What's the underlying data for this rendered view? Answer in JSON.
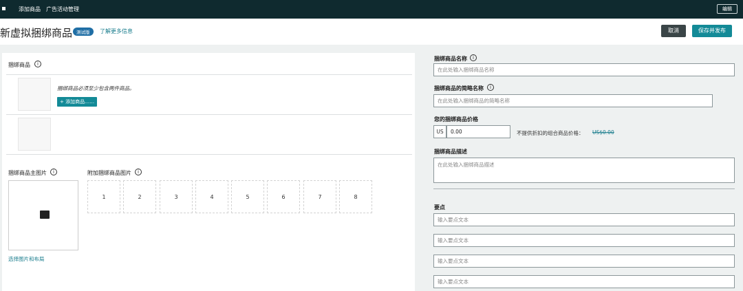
{
  "topbar": {
    "nav1": "添加商品",
    "nav2": "广告活动管理",
    "edit": "编辑"
  },
  "header": {
    "title": "新虚拟捆绑商品",
    "badge": "测试版",
    "learn_more": "了解更多信息",
    "cancel": "取消",
    "save_publish": "保存并发布"
  },
  "left": {
    "bundle_label": "捆绑商品",
    "bundle_hint": "捆绑商品必须至少包含两件商品。",
    "add_product": "+ 添加商品……",
    "main_image_label": "捆绑商品主图片",
    "extra_images_label": "附加捆绑商品图片",
    "slots": [
      "1",
      "2",
      "3",
      "4",
      "5",
      "6",
      "7",
      "8"
    ],
    "choose_image": "选择图片和布局"
  },
  "right": {
    "name_label": "捆绑商品名称",
    "name_placeholder": "在此处输入捆绑商品名称",
    "short_label": "捆绑商品的简略名称",
    "short_placeholder": "在此处输入捆绑商品的简略名称",
    "price_label": "您的捆绑商品价格",
    "currency": "US",
    "price_value": "0.00",
    "no_discount_label": "不提供折扣的组合商品价格：",
    "no_discount_price": "US$0.00",
    "desc_label": "捆绑商品描述",
    "desc_placeholder": "在此处输入捆绑商品描述",
    "points_label": "要点",
    "point_placeholders": [
      "输入要点文本",
      "输入要点文本",
      "输入要点文本",
      "输入要点文本"
    ]
  }
}
